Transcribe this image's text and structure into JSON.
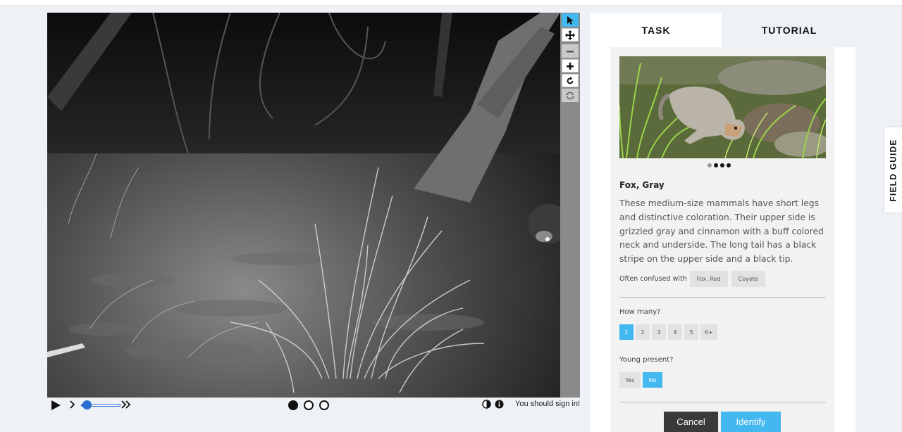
{
  "viewer": {
    "tools": [
      {
        "name": "pointer",
        "icon": "pointer-icon",
        "active": true
      },
      {
        "name": "pan",
        "icon": "move-icon",
        "active": false
      },
      {
        "name": "zoom-out",
        "icon": "minus-icon",
        "active": false
      },
      {
        "name": "zoom-in",
        "icon": "plus-icon",
        "active": false
      },
      {
        "name": "rotate",
        "icon": "rotate-icon",
        "active": false
      },
      {
        "name": "reset",
        "icon": "refresh-icon",
        "active": false
      }
    ],
    "frames": [
      {
        "selected": true
      },
      {
        "selected": false
      },
      {
        "selected": false
      }
    ],
    "signin_text": "You should sign in!"
  },
  "tabs": {
    "task": "TASK",
    "tutorial": "TUTORIAL"
  },
  "species": {
    "name": "Fox, Gray",
    "description": "These medium-size mammals have short legs and distinctive coloration. Their upper side is grizzled gray and cinnamon with a buff colored neck and underside. The long tail has a black stripe on the upper side and a black tip.",
    "confused_label": "Often confused with",
    "confused_with": [
      "Fox, Red",
      "Coyote"
    ],
    "image_count": 4,
    "image_index": 0
  },
  "questions": {
    "how_many": {
      "label": "How many?",
      "options": [
        "1",
        "2",
        "3",
        "4",
        "5",
        "6+"
      ],
      "selected": "1"
    },
    "young": {
      "label": "Young present?",
      "options": [
        "Yes",
        "No"
      ],
      "selected": "No"
    }
  },
  "buttons": {
    "cancel": "Cancel",
    "identify": "Identify"
  },
  "field_guide": "FIELD GUIDE",
  "colors": {
    "accent": "#43b7ef",
    "dark": "#3a3a3a"
  }
}
